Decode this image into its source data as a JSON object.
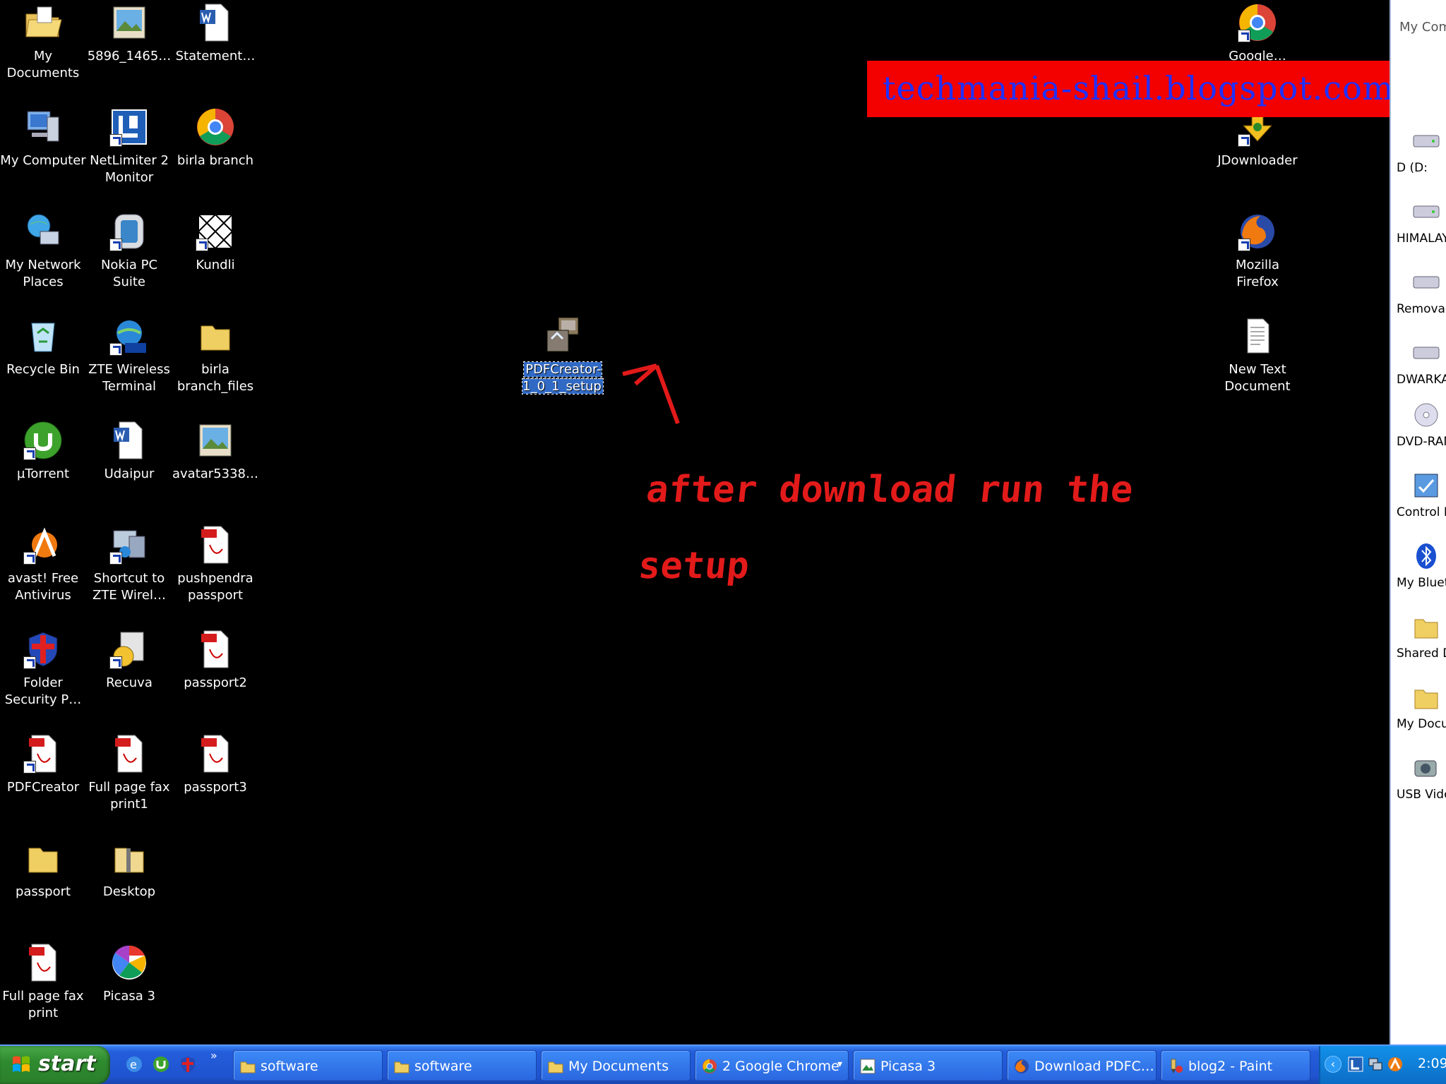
{
  "desktop": {
    "icons": [
      {
        "name": "my-documents-icon",
        "label": "My Documents",
        "kind": "folder-open"
      },
      {
        "name": "image-file-icon",
        "label": "5896_1465…",
        "kind": "image"
      },
      {
        "name": "word-doc-icon",
        "label": "Statement…",
        "kind": "word"
      },
      {
        "name": "my-computer-icon",
        "label": "My Computer",
        "kind": "computer"
      },
      {
        "name": "netlimiter-icon",
        "label": "NetLimiter 2 Monitor",
        "kind": "netlimiter"
      },
      {
        "name": "chrome-icon",
        "label": "birla branch",
        "kind": "chrome"
      },
      {
        "name": "network-places-icon",
        "label": "My Network Places",
        "kind": "network"
      },
      {
        "name": "nokia-pc-suite-icon",
        "label": "Nokia PC Suite",
        "kind": "nokia"
      },
      {
        "name": "kundli-icon",
        "label": "Kundli",
        "kind": "kundli"
      },
      {
        "name": "recycle-bin-icon",
        "label": "Recycle Bin",
        "kind": "recycle"
      },
      {
        "name": "zte-terminal-icon",
        "label": "ZTE Wireless Terminal",
        "kind": "zte"
      },
      {
        "name": "folder-icon",
        "label": "birla branch_files",
        "kind": "folder"
      },
      {
        "name": "utorrent-icon",
        "label": "µTorrent",
        "kind": "utorrent"
      },
      {
        "name": "word-doc-icon",
        "label": "Udaipur",
        "kind": "word"
      },
      {
        "name": "image-file-icon",
        "label": "avatar5338…",
        "kind": "image"
      },
      {
        "name": "avast-icon",
        "label": "avast! Free Antivirus",
        "kind": "avast"
      },
      {
        "name": "zte-shortcut-icon",
        "label": "Shortcut to ZTE Wirel…",
        "kind": "zte"
      },
      {
        "name": "pdf-file-icon",
        "label": "pushpendra passport",
        "kind": "pdf"
      },
      {
        "name": "folder-security-icon",
        "label": "Folder Security P…",
        "kind": "shield"
      },
      {
        "name": "recuva-icon",
        "label": "Recuva",
        "kind": "recuva"
      },
      {
        "name": "pdf-file-icon",
        "label": "passport2",
        "kind": "pdf"
      },
      {
        "name": "pdfcreator-icon",
        "label": "PDFCreator",
        "kind": "pdf"
      },
      {
        "name": "pdf-file-icon",
        "label": "Full page fax print1",
        "kind": "pdf"
      },
      {
        "name": "pdf-file-icon",
        "label": "passport3",
        "kind": "pdf"
      },
      {
        "name": "folder-icon",
        "label": "passport",
        "kind": "folder"
      },
      {
        "name": "zip-folder-icon",
        "label": "Desktop",
        "kind": "zip"
      },
      {
        "name": "pdf-file-icon",
        "label": "Full page fax print",
        "kind": "pdf"
      },
      {
        "name": "picasa-icon",
        "label": "Picasa 3",
        "kind": "picasa"
      },
      {
        "name": "chrome-icon",
        "label": "Google…",
        "kind": "chrome"
      },
      {
        "name": "jdownloader-icon",
        "label": "JDownloader",
        "kind": "jdownloader"
      },
      {
        "name": "firefox-icon",
        "label": "Mozilla Firefox",
        "kind": "firefox"
      },
      {
        "name": "text-document-icon",
        "label": "New Text Document",
        "kind": "text"
      },
      {
        "name": "setup-file-icon",
        "label": "PDFCreator-1_0_1_setup",
        "kind": "setup"
      }
    ]
  },
  "banner": {
    "text": "techmania-shail.blogspot.com"
  },
  "annotation": {
    "line1": "after download run the",
    "line2": "setup"
  },
  "side_panel": {
    "header": "My Comp",
    "items": [
      {
        "label": "D (D:",
        "icon": "drive-icon"
      },
      {
        "label": "HIMALAY",
        "icon": "drive-icon"
      },
      {
        "label": "Removab",
        "icon": "drive-icon"
      },
      {
        "label": "DWARKA",
        "icon": "drive-icon"
      },
      {
        "label": "DVD-RAM",
        "icon": "dvd-icon"
      },
      {
        "label": "Control P",
        "icon": "control-panel-icon"
      },
      {
        "label": "My Blueto",
        "icon": "bluetooth-icon"
      },
      {
        "label": "Shared D",
        "icon": "folder-icon"
      },
      {
        "label": "My Docu",
        "icon": "folder-icon"
      },
      {
        "label": "USB Vide",
        "icon": "webcam-icon"
      }
    ]
  },
  "taskbar": {
    "start_label": "start",
    "quicklaunch_more": "»",
    "tasks": [
      {
        "label": "software",
        "icon": "folder-icon"
      },
      {
        "label": "software",
        "icon": "folder-icon"
      },
      {
        "label": "My Documents",
        "icon": "folder-icon"
      },
      {
        "label": "2 Google Chrome",
        "icon": "chrome-icon",
        "dropdown": "▾"
      },
      {
        "label": "Picasa 3",
        "icon": "picasa-icon"
      },
      {
        "label": "Download PDFC…",
        "icon": "firefox-icon"
      },
      {
        "label": "blog2 - Paint",
        "icon": "paint-icon"
      }
    ],
    "tray_chevron": "‹",
    "clock": "2:09"
  },
  "colors": {
    "banner_bg": "#f30000",
    "banner_text": "#2030ff",
    "annotation": "#e21a1a",
    "taskbar": "#245edb",
    "start": "#2f8b2f",
    "selection": "#316ac5"
  }
}
